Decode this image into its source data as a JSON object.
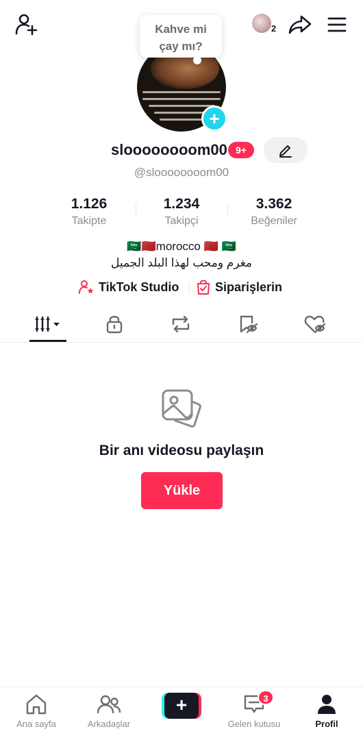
{
  "header": {
    "friends_count": "2",
    "bubble_text_line1": "Kahve mi",
    "bubble_text_line2": "çay mı?"
  },
  "profile": {
    "display_name": "sloooooooom00",
    "notification_badge": "9+",
    "handle": "@sloooooooom00",
    "bio_line1": "🇸🇦🇲🇦morocco 🇲🇦 🇸🇦",
    "bio_line2": "مغرم ومحب لهذا البلد الجميل"
  },
  "stats": [
    {
      "value": "1.126",
      "label": "Takipte"
    },
    {
      "value": "1.234",
      "label": "Takipçi"
    },
    {
      "value": "3.362",
      "label": "Beğeniler"
    }
  ],
  "links": {
    "studio": "TikTok Studio",
    "orders": "Siparişlerin"
  },
  "tabs": [
    "videos-grid-icon",
    "lock-icon",
    "repost-icon",
    "favorites-icon",
    "liked-heart-icon"
  ],
  "empty_state": {
    "title": "Bir anı videosu paylaşın",
    "upload_label": "Yükle"
  },
  "bottom_nav": [
    {
      "label": "Ana sayfa",
      "icon": "home-icon"
    },
    {
      "label": "Arkadaşlar",
      "icon": "friends-icon"
    },
    {
      "label": "",
      "icon": "create-icon"
    },
    {
      "label": "Gelen kutusu",
      "icon": "inbox-icon",
      "badge": "3"
    },
    {
      "label": "Profil",
      "icon": "profile-icon"
    }
  ],
  "colors": {
    "accent": "#fe2c55",
    "cyan": "#25f4ee",
    "text_primary": "#161823",
    "text_secondary": "#8a8b91"
  }
}
